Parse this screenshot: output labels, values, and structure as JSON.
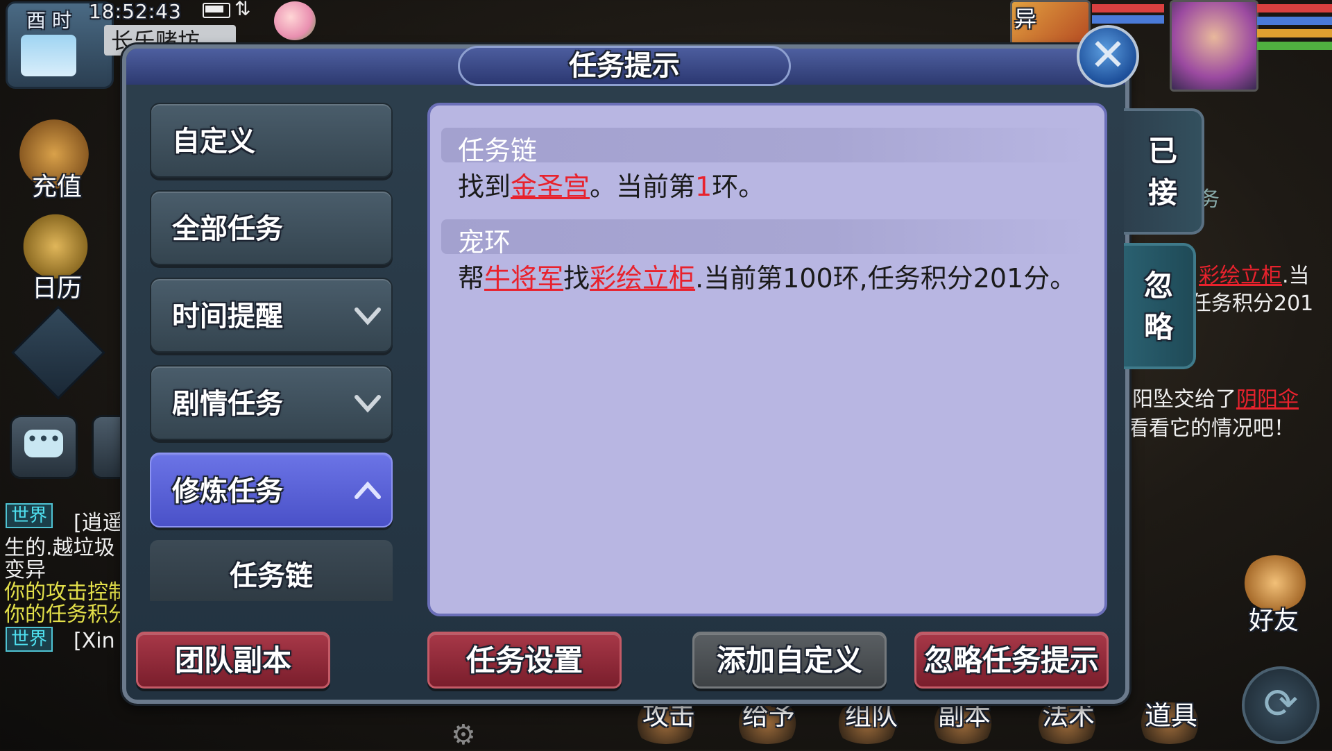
{
  "status_bar": {
    "shichen": "酉 时",
    "time": "18:52:43",
    "location": "长乐赌坊"
  },
  "hud_left": {
    "recharge_label": "充值",
    "calendar_label": "日历",
    "chat_icon": "speech-bubble-icon",
    "chat_glyph": "•••"
  },
  "chat": [
    {
      "channel": "世界",
      "text": "[逍遥"
    },
    {
      "text": "生的.越垃圾"
    },
    {
      "text": "变异"
    },
    {
      "text": "你的攻击控制"
    },
    {
      "text": "你的任务积分"
    },
    {
      "channel": "世界",
      "text": "[Xin"
    }
  ],
  "hud_right": {
    "pet_badge": "异",
    "friends_label": "好友",
    "refresh_glyph": "⟳"
  },
  "background_text": {
    "line1_link": "彩绘立柜",
    "line1_suffix": ".当",
    "line2": "任务积分201",
    "line3_prefix": "阳坠交给了",
    "line3_link": "阴阳伞",
    "line4": "看看它的情况吧！",
    "tab_partial": "务"
  },
  "bottom_bar": [
    "攻击",
    "给予",
    "组队",
    "副本",
    "法术",
    "道具"
  ],
  "dialog": {
    "title": "任务提示",
    "close_glyph": "✕",
    "categories": [
      {
        "label": "自定义"
      },
      {
        "label": "全部任务"
      },
      {
        "label": "时间提醒",
        "chevron": "down"
      },
      {
        "label": "剧情任务",
        "chevron": "down"
      },
      {
        "label": "修炼任务",
        "chevron": "up",
        "active": true
      }
    ],
    "sub_items": [
      {
        "label": "任务链"
      }
    ],
    "sections": [
      {
        "title": "任务链",
        "body": {
          "p1": "找到",
          "link1": "金圣宫",
          "p2": "。当前第",
          "num": "1",
          "p3": "环。"
        }
      },
      {
        "title": "宠环",
        "body": {
          "p1": "帮",
          "link1": "牛将军",
          "p2": "找",
          "link2": "彩绘立柜",
          "p3": ".当前第100环,任务积分201分。"
        }
      }
    ],
    "side_tabs": [
      {
        "label_line1": "已",
        "label_line2": "接"
      },
      {
        "label_line1": "忽",
        "label_line2": "略"
      }
    ],
    "actions": {
      "team_dungeon": "团队副本",
      "task_settings": "任务设置",
      "add_custom": "添加自定义",
      "ignore_tips": "忽略任务提示"
    }
  },
  "colors": {
    "highlight_red": "#e8222d",
    "content_bg": "#b8b6e2",
    "active_tab": "#5a61d6",
    "action_red": "#8e2a38"
  }
}
